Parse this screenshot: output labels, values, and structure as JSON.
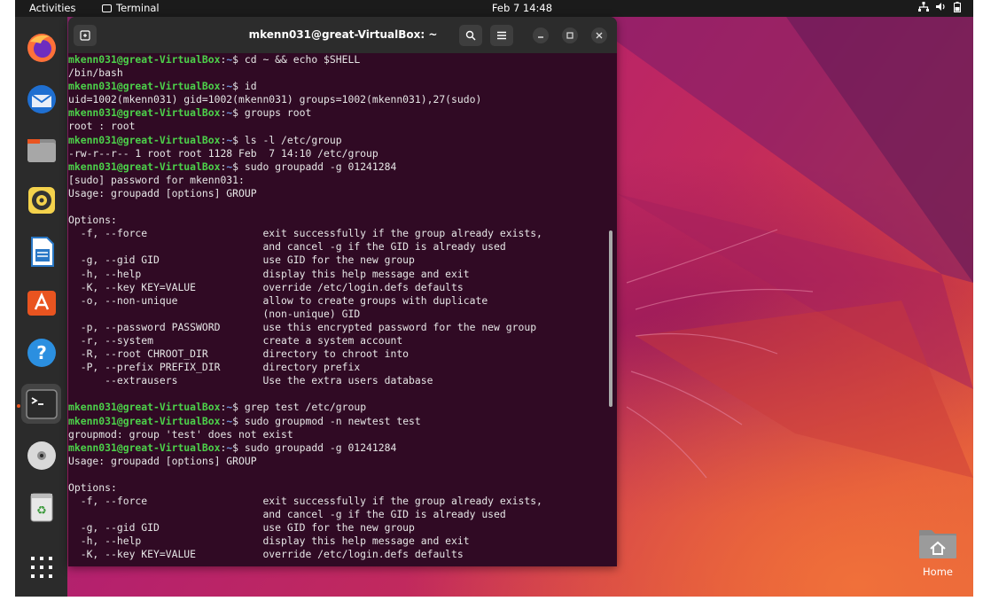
{
  "topbar": {
    "activities": "Activities",
    "app_name": "Terminal",
    "clock": "Feb 7  14:48",
    "tray_icons": [
      "network-icon",
      "volume-icon",
      "battery-icon"
    ]
  },
  "dock": {
    "items": [
      {
        "name": "firefox",
        "icon": "firefox-icon"
      },
      {
        "name": "thunderbird",
        "icon": "thunderbird-icon"
      },
      {
        "name": "files",
        "icon": "files-icon"
      },
      {
        "name": "rhythmbox",
        "icon": "rhythmbox-icon"
      },
      {
        "name": "writer",
        "icon": "libreoffice-writer-icon"
      },
      {
        "name": "software",
        "icon": "app-center-icon"
      },
      {
        "name": "help",
        "icon": "help-icon"
      },
      {
        "name": "terminal",
        "icon": "terminal-icon",
        "active": true
      },
      {
        "name": "dvd",
        "icon": "optical-disc-icon"
      },
      {
        "name": "trash",
        "icon": "trash-icon"
      },
      {
        "name": "show-apps",
        "icon": "app-grid-icon"
      }
    ]
  },
  "terminal": {
    "title": "mkenn031@great-VirtualBox: ~",
    "prompt_user": "mkenn031@great-VirtualBox",
    "prompt_sep": ":",
    "prompt_path": "~",
    "prompt_end": "$ ",
    "lines": [
      {
        "type": "cmd",
        "text": "cd ~ && echo $SHELL"
      },
      {
        "type": "out",
        "text": "/bin/bash"
      },
      {
        "type": "cmd",
        "text": "id"
      },
      {
        "type": "out",
        "text": "uid=1002(mkenn031) gid=1002(mkenn031) groups=1002(mkenn031),27(sudo)"
      },
      {
        "type": "cmd",
        "text": "groups root"
      },
      {
        "type": "out",
        "text": "root : root"
      },
      {
        "type": "cmd",
        "text": "ls -l /etc/group"
      },
      {
        "type": "out",
        "text": "-rw-r--r-- 1 root root 1128 Feb  7 14:10 /etc/group"
      },
      {
        "type": "cmd",
        "text": "sudo groupadd -g 01241284"
      },
      {
        "type": "out",
        "text": "[sudo] password for mkenn031:"
      },
      {
        "type": "out",
        "text": "Usage: groupadd [options] GROUP"
      },
      {
        "type": "out",
        "text": ""
      },
      {
        "type": "out",
        "text": "Options:"
      },
      {
        "type": "out",
        "text": "  -f, --force                   exit successfully if the group already exists,"
      },
      {
        "type": "out",
        "text": "                                and cancel -g if the GID is already used"
      },
      {
        "type": "out",
        "text": "  -g, --gid GID                 use GID for the new group"
      },
      {
        "type": "out",
        "text": "  -h, --help                    display this help message and exit"
      },
      {
        "type": "out",
        "text": "  -K, --key KEY=VALUE           override /etc/login.defs defaults"
      },
      {
        "type": "out",
        "text": "  -o, --non-unique              allow to create groups with duplicate"
      },
      {
        "type": "out",
        "text": "                                (non-unique) GID"
      },
      {
        "type": "out",
        "text": "  -p, --password PASSWORD       use this encrypted password for the new group"
      },
      {
        "type": "out",
        "text": "  -r, --system                  create a system account"
      },
      {
        "type": "out",
        "text": "  -R, --root CHROOT_DIR         directory to chroot into"
      },
      {
        "type": "out",
        "text": "  -P, --prefix PREFIX_DIR       directory prefix"
      },
      {
        "type": "out",
        "text": "      --extrausers              Use the extra users database"
      },
      {
        "type": "out",
        "text": ""
      },
      {
        "type": "cmd",
        "text": "grep test /etc/group"
      },
      {
        "type": "cmd",
        "text": "sudo groupmod -n newtest test"
      },
      {
        "type": "out",
        "text": "groupmod: group 'test' does not exist"
      },
      {
        "type": "cmd",
        "text": "sudo groupadd -g 01241284"
      },
      {
        "type": "out",
        "text": "Usage: groupadd [options] GROUP"
      },
      {
        "type": "out",
        "text": ""
      },
      {
        "type": "out",
        "text": "Options:"
      },
      {
        "type": "out",
        "text": "  -f, --force                   exit successfully if the group already exists,"
      },
      {
        "type": "out",
        "text": "                                and cancel -g if the GID is already used"
      },
      {
        "type": "out",
        "text": "  -g, --gid GID                 use GID for the new group"
      },
      {
        "type": "out",
        "text": "  -h, --help                    display this help message and exit"
      },
      {
        "type": "out",
        "text": "  -K, --key KEY=VALUE           override /etc/login.defs defaults"
      }
    ]
  },
  "desktop": {
    "home_label": "Home"
  },
  "colors": {
    "terminal_bg": "#300a24",
    "prompt_user": "#4cd14a",
    "prompt_path": "#6a8fd8",
    "accent": "#e95420"
  }
}
